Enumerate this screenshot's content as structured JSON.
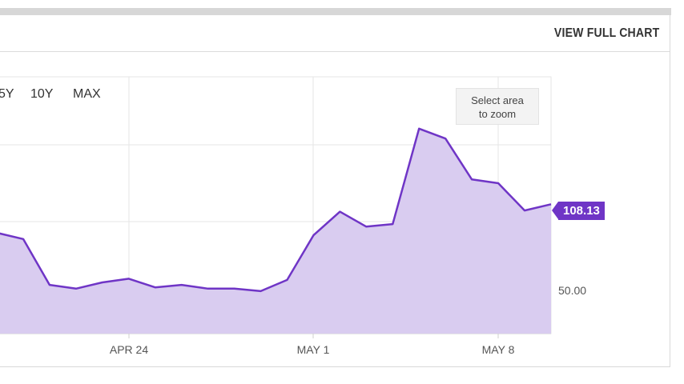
{
  "header": {
    "view_full_chart_label": "VIEW FULL CHART"
  },
  "range_buttons": [
    "5Y",
    "10Y",
    "MAX"
  ],
  "zoom_hint": {
    "line1": "Select area",
    "line2": "to zoom"
  },
  "last_price_label": "108.13",
  "y_axis_label": "50.00",
  "x_axis_labels": [
    "APR 24",
    "MAY 1",
    "MAY 8"
  ],
  "colors": {
    "accent": "#6f35c6",
    "fill": "#d9ccf0",
    "grid": "#e6e6e6"
  },
  "chart_data": {
    "type": "area",
    "series": [
      {
        "values": [
          80,
          75,
          38,
          35,
          40,
          43,
          36,
          38,
          35,
          35,
          33,
          42,
          78,
          97,
          85,
          87,
          164,
          156,
          123,
          120,
          98,
          103
        ]
      }
    ],
    "y_reference": 50,
    "last_value": 108.13
  }
}
